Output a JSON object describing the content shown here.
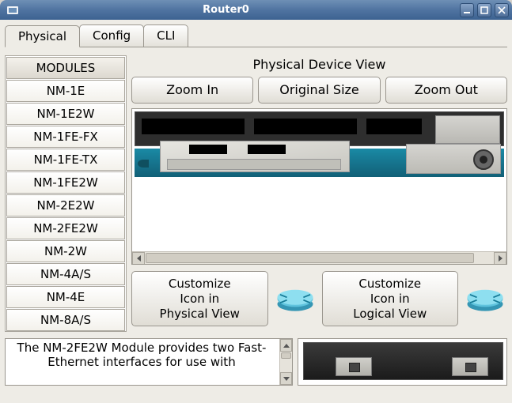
{
  "window": {
    "title": "Router0"
  },
  "tabs": [
    {
      "label": "Physical",
      "active": true
    },
    {
      "label": "Config",
      "active": false
    },
    {
      "label": "CLI",
      "active": false
    }
  ],
  "module_list": {
    "header": "MODULES",
    "items": [
      "NM-1E",
      "NM-1E2W",
      "NM-1FE-FX",
      "NM-1FE-TX",
      "NM-1FE2W",
      "NM-2E2W",
      "NM-2FE2W",
      "NM-2W",
      "NM-4A/S",
      "NM-4E",
      "NM-8A/S"
    ]
  },
  "device_view": {
    "label": "Physical Device View",
    "zoom_in": "Zoom In",
    "original_size": "Original Size",
    "zoom_out": "Zoom Out"
  },
  "customize": {
    "physical_line1": "Customize",
    "physical_line2": "Icon in",
    "physical_line3": "Physical View",
    "logical_line1": "Customize",
    "logical_line2": "Icon in",
    "logical_line3": "Logical View"
  },
  "description": "The NM-2FE2W Module provides two Fast-Ethernet interfaces for use with"
}
